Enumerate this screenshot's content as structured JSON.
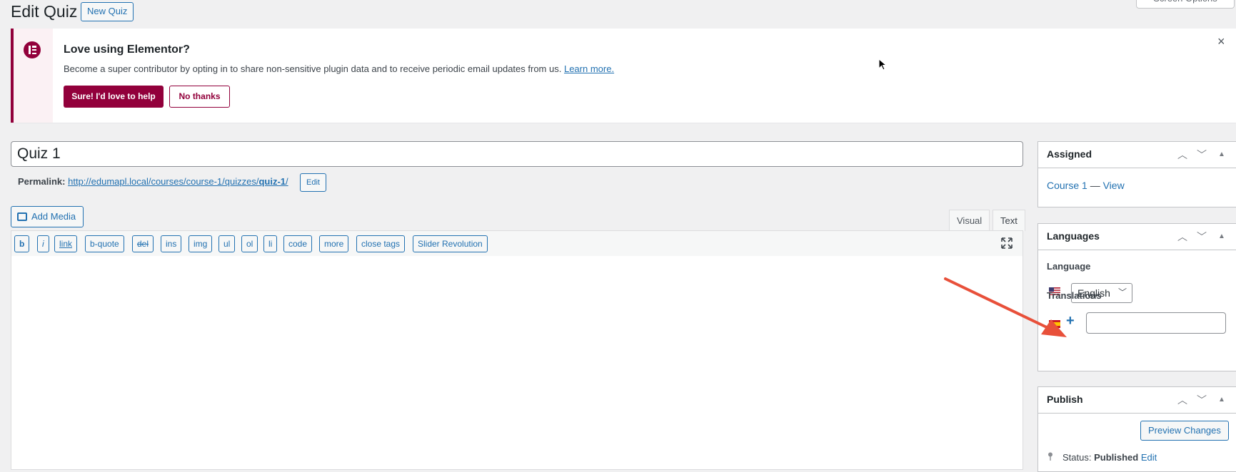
{
  "header": {
    "title": "Edit Quiz",
    "new_button": "New Quiz",
    "screen_options": "Screen Options"
  },
  "notice": {
    "title": "Love using Elementor?",
    "text": "Become a super contributor by opting in to share non-sensitive plugin data and to receive periodic email updates from us.",
    "link": "Learn more.",
    "primary_button": "Sure! I'd love to help",
    "secondary_button": "No thanks",
    "close_icon": "×",
    "icon": "elementor-logo-icon",
    "accent_color": "#92003b"
  },
  "post": {
    "title_value": "Quiz 1",
    "permalink_label": "Permalink:",
    "permalink_base": "http://edumapl.local/courses/course-1/quizzes/",
    "permalink_slug": "quiz-1",
    "permalink_end": "/",
    "permalink_edit": "Edit"
  },
  "editor": {
    "add_media": "Add Media",
    "tabs": [
      "Visual",
      "Text"
    ],
    "quicktags": [
      "b",
      "i",
      "link",
      "b-quote",
      "del",
      "ins",
      "img",
      "ul",
      "ol",
      "li",
      "code",
      "more",
      "close tags",
      "Slider Revolution"
    ]
  },
  "sidebar": {
    "assigned": {
      "title": "Assigned",
      "course": "Course 1",
      "separator": "—",
      "view": "View"
    },
    "languages": {
      "title": "Languages",
      "language_label": "Language",
      "selected_language": "English",
      "translations_label": "Translations",
      "flags": [
        "us-flag-icon",
        "es-flag-icon"
      ]
    },
    "publish": {
      "title": "Publish",
      "preview_button": "Preview Changes",
      "status_label": "Status:",
      "status_value": "Published",
      "status_edit": "Edit"
    },
    "controls": [
      "chevron-up-icon",
      "chevron-down-icon",
      "triangle-toggle-icon"
    ]
  },
  "colors": {
    "link": "#2271b1",
    "background": "#f0f0f1",
    "annotation_arrow": "#e8503a"
  }
}
